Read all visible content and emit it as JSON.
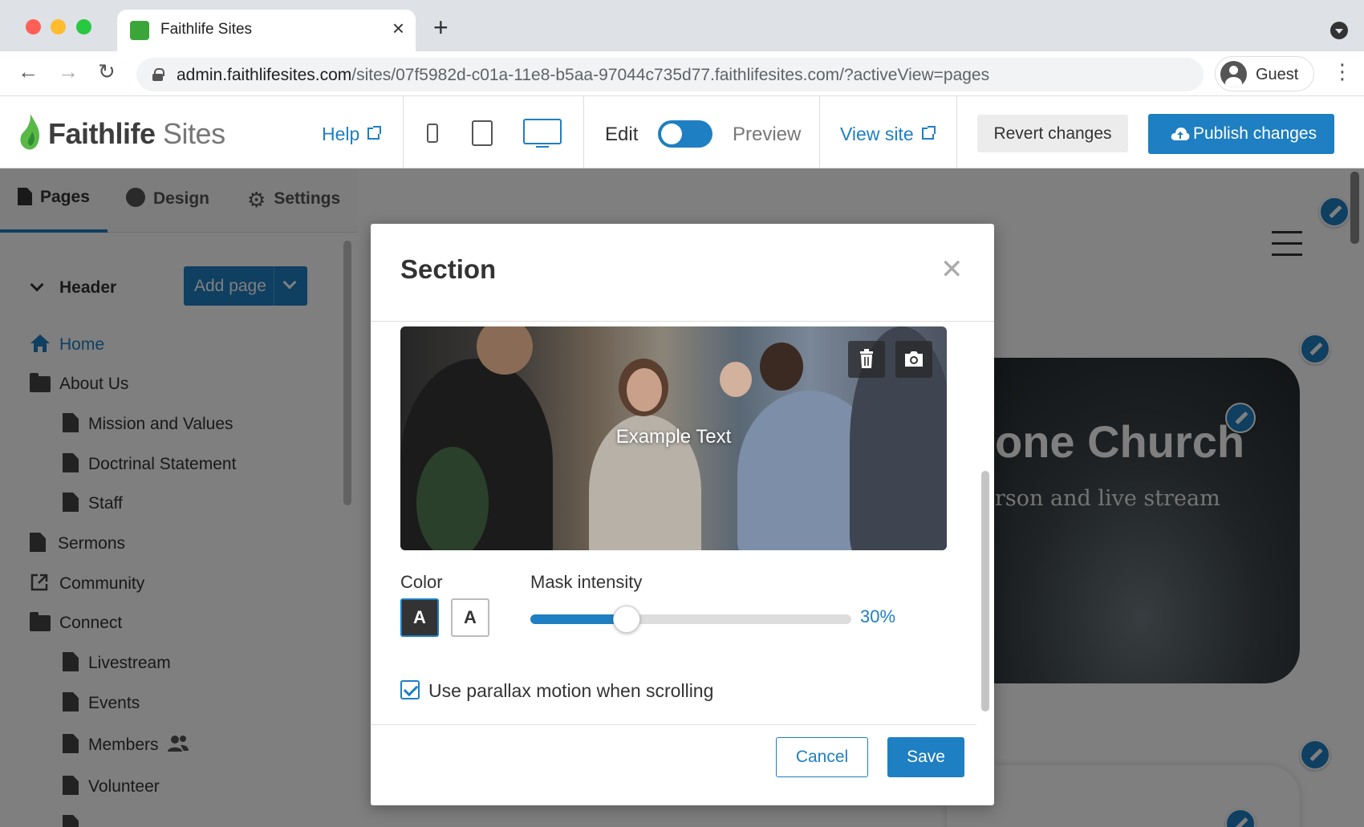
{
  "browser": {
    "tab_title": "Faithlife Sites",
    "url_host": "admin.faithlifesites.com",
    "url_path": "/sites/07f5982d-c01a-11e8-b5aa-97044c735d77.faithlifesites.com/?activeView=pages",
    "profile_label": "Guest"
  },
  "app_header": {
    "logo_bold": "Faithlife",
    "logo_light": "Sites",
    "help_label": "Help",
    "edit_label": "Edit",
    "preview_label": "Preview",
    "view_site_label": "View site",
    "revert_label": "Revert changes",
    "publish_label": "Publish changes",
    "brand_color": "#1e7fc2"
  },
  "left_panel": {
    "tabs": [
      {
        "label": "Pages",
        "icon": "page-icon",
        "active": true
      },
      {
        "label": "Design",
        "icon": "palette-icon"
      },
      {
        "label": "Settings",
        "icon": "gear-icon"
      }
    ],
    "section_label": "Header",
    "add_page_label": "Add page",
    "nav": [
      {
        "label": "Home",
        "icon": "home-icon",
        "active": true
      },
      {
        "label": "About Us",
        "icon": "folder-icon"
      },
      {
        "label": "Mission and Values",
        "icon": "page-icon"
      },
      {
        "label": "Doctrinal Statement",
        "icon": "page-icon"
      },
      {
        "label": "Staff",
        "icon": "page-icon"
      },
      {
        "label": "Sermons",
        "icon": "page-icon"
      },
      {
        "label": "Community",
        "icon": "external-link-icon"
      },
      {
        "label": "Connect",
        "icon": "folder-icon"
      },
      {
        "label": "Livestream",
        "icon": "page-icon"
      },
      {
        "label": "Events",
        "icon": "page-icon"
      },
      {
        "label": "Members",
        "icon": "page-icon",
        "badge_icon": "users-icon"
      },
      {
        "label": "Volunteer",
        "icon": "page-icon"
      }
    ]
  },
  "site_preview": {
    "hero_title": "one Church",
    "hero_subtitle": "rson and live stream"
  },
  "modal": {
    "title": "Section",
    "image_text": "Example Text",
    "color_label": "Color",
    "swatch_dark": "A",
    "swatch_light": "A",
    "mask_label": "Mask intensity",
    "mask_value": 0.3,
    "mask_value_text": "30%",
    "parallax_label": "Use parallax motion when scrolling",
    "parallax_checked": true,
    "cancel_label": "Cancel",
    "save_label": "Save"
  }
}
